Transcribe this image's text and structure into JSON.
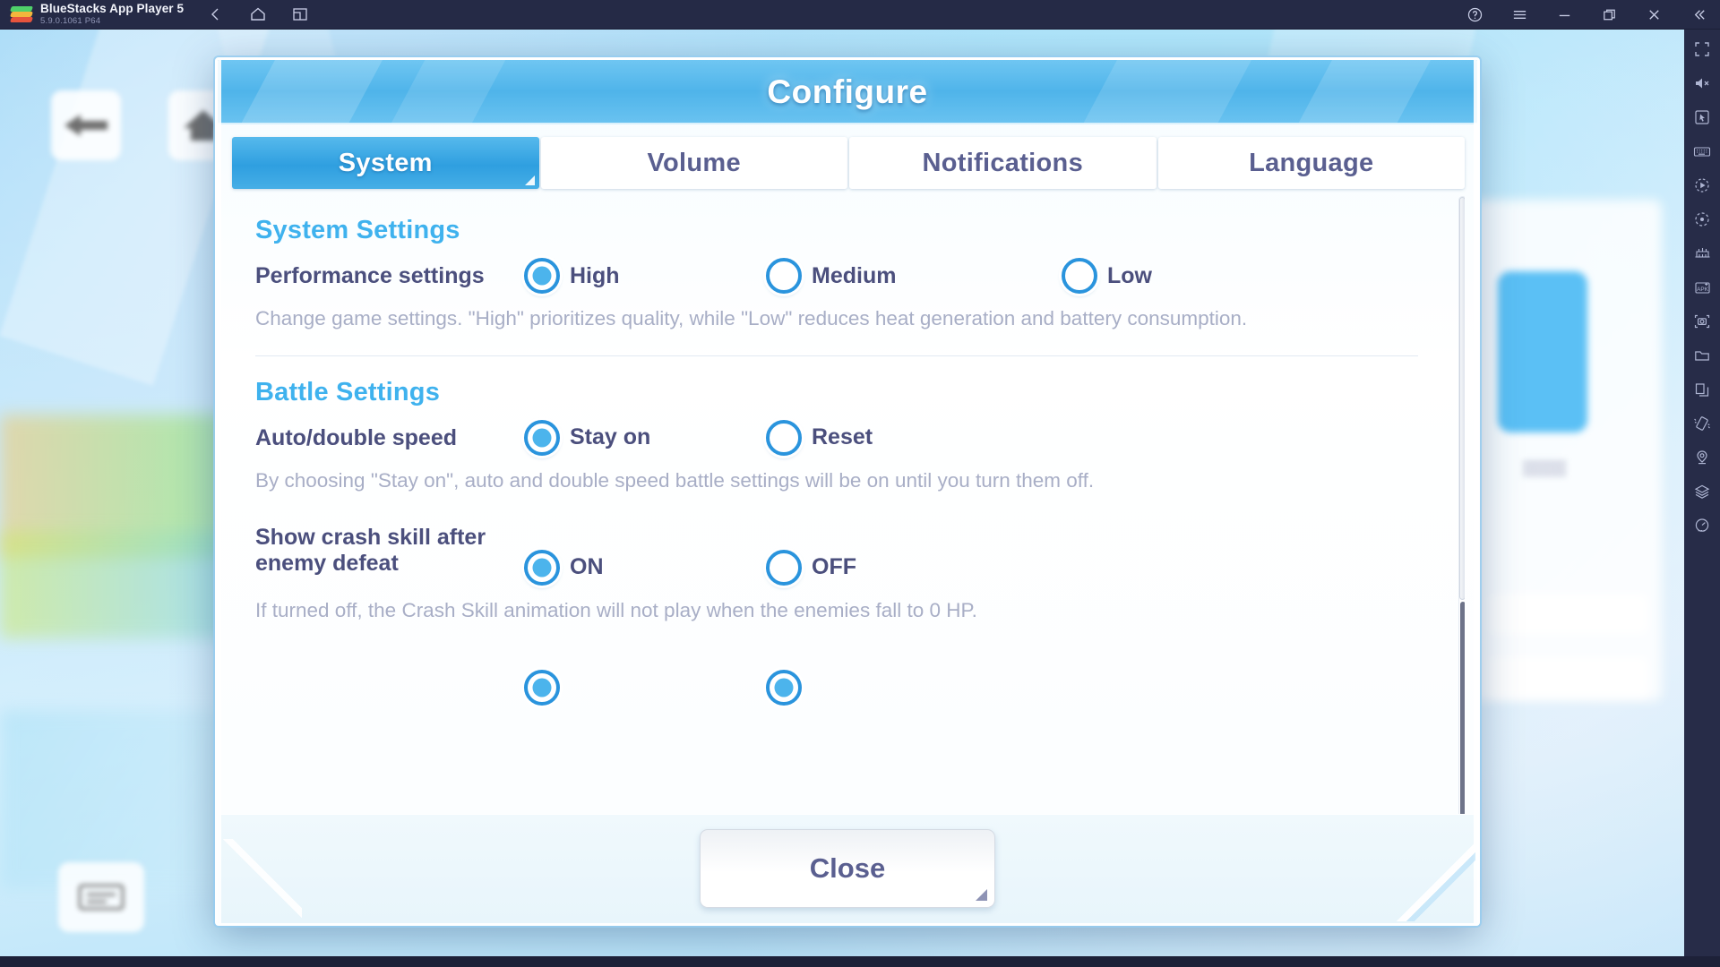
{
  "titlebar": {
    "app_name": "BlueStacks App Player 5",
    "version": "5.9.0.1061 P64",
    "nav_icons": [
      "back-arrow-icon",
      "home-icon",
      "multi-window-icon"
    ],
    "right_icons": [
      "help-icon",
      "menu-icon",
      "minimize-icon",
      "maximize-icon",
      "close-icon",
      "collapse-icon"
    ]
  },
  "sidebar": {
    "items": [
      {
        "name": "fullscreen-icon"
      },
      {
        "name": "mute-icon"
      },
      {
        "name": "cursor-icon"
      },
      {
        "name": "keyboard-controls-icon"
      },
      {
        "name": "macro-recorder-icon"
      },
      {
        "name": "script-icon"
      },
      {
        "name": "multi-instance-icon"
      },
      {
        "name": "install-apk-icon"
      },
      {
        "name": "screenshot-icon"
      },
      {
        "name": "media-manager-icon"
      },
      {
        "name": "copy-instance-icon"
      },
      {
        "name": "shake-icon"
      },
      {
        "name": "location-icon"
      },
      {
        "name": "layers-icon"
      },
      {
        "name": "performance-icon"
      }
    ]
  },
  "dialog": {
    "title": "Configure",
    "tabs": [
      {
        "label": "System",
        "active": true
      },
      {
        "label": "Volume",
        "active": false
      },
      {
        "label": "Notifications",
        "active": false
      },
      {
        "label": "Language",
        "active": false
      }
    ],
    "sections": [
      {
        "heading": "System Settings",
        "rows": [
          {
            "label": "Performance settings",
            "options": [
              {
                "label": "High",
                "selected": true
              },
              {
                "label": "Medium",
                "selected": false
              },
              {
                "label": "Low",
                "selected": false
              }
            ],
            "description": "Change game settings. \"High\" prioritizes quality, while \"Low\" reduces heat generation and battery consumption."
          }
        ]
      },
      {
        "heading": "Battle Settings",
        "rows": [
          {
            "label": "Auto/double speed",
            "options": [
              {
                "label": "Stay on",
                "selected": true
              },
              {
                "label": "Reset",
                "selected": false
              }
            ],
            "description": "By choosing \"Stay on\", auto and double speed battle settings will be on until you turn them off."
          },
          {
            "label": "Show crash skill after enemy defeat",
            "options": [
              {
                "label": "ON",
                "selected": true
              },
              {
                "label": "OFF",
                "selected": false
              }
            ],
            "description": "If turned off, the Crash Skill animation will not play when the enemies fall to 0 HP."
          }
        ]
      }
    ],
    "footer": {
      "close_label": "Close"
    },
    "scroll": {
      "position_percent": 0
    }
  },
  "colors": {
    "accent_blue": "#3fb2ee",
    "tab_active": "#2f9fe0",
    "label_text": "#4b4f7d",
    "desc_text": "#a8aec6",
    "chrome_bg": "#252a46"
  }
}
